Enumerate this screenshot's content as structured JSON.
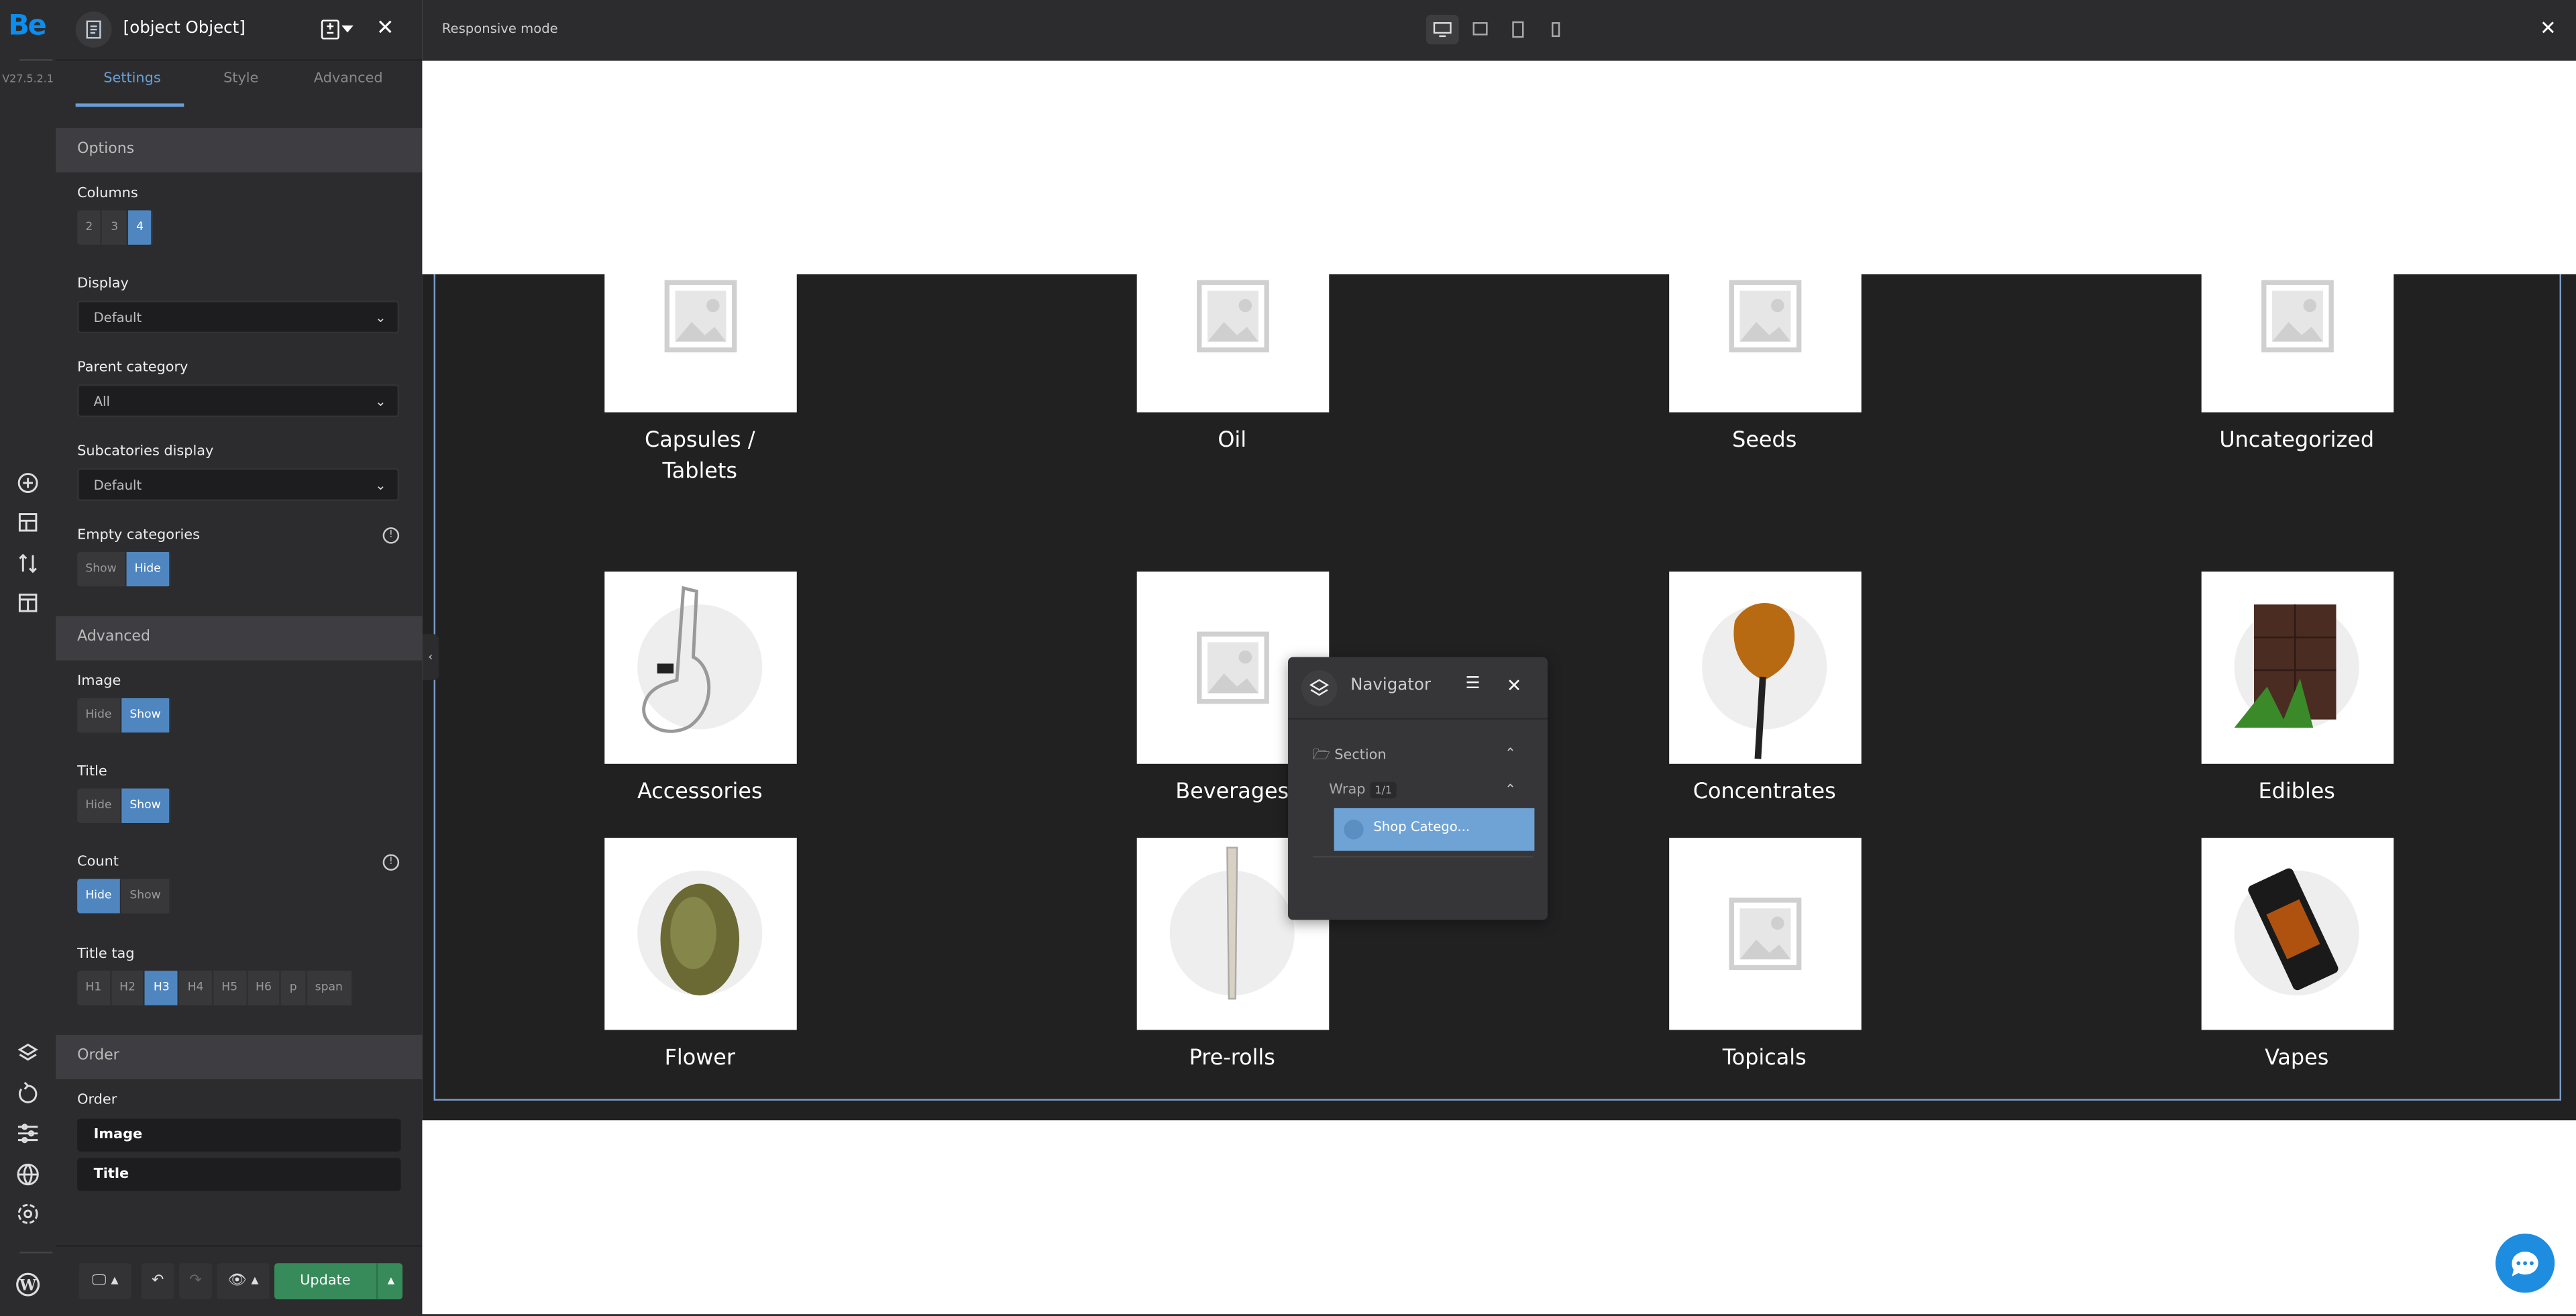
{
  "rail": {
    "logo": "Be",
    "version": "V27.5.2.1"
  },
  "panel": {
    "title": {
      "label": "Title",
      "options": [
        "Hide",
        "Show"
      ],
      "selected": "Show"
    },
    "tabs": [
      "Settings",
      "Style",
      "Advanced"
    ],
    "options_header": "Options",
    "columns": {
      "label": "Columns",
      "options": [
        "2",
        "3",
        "4"
      ],
      "selected": "4"
    },
    "display": {
      "label": "Display",
      "value": "Default"
    },
    "parent_category": {
      "label": "Parent category",
      "value": "All"
    },
    "subcategories_display": {
      "label": "Subcatories display",
      "value": "Default"
    },
    "empty_categories": {
      "label": "Empty categories",
      "options": [
        "Show",
        "Hide"
      ],
      "selected": "Hide"
    },
    "advanced_header": "Advanced",
    "image": {
      "label": "Image",
      "options": [
        "Hide",
        "Show"
      ],
      "selected": "Show"
    },
    "count": {
      "label": "Count",
      "options": [
        "Hide",
        "Show"
      ],
      "selected": "Hide"
    },
    "title_tag": {
      "label": "Title tag",
      "options": [
        "H1",
        "H2",
        "H3",
        "H4",
        "H5",
        "H6",
        "p",
        "span"
      ],
      "selected": "H3"
    },
    "order_header": "Order",
    "order": {
      "label": "Order",
      "items": [
        "Image",
        "Title"
      ]
    },
    "update_label": "Update"
  },
  "canvas": {
    "mode_label": "Responsive mode",
    "active_device": "desktop",
    "categories": [
      {
        "title": "Capsules / Tablets",
        "image": "placeholder"
      },
      {
        "title": "Oil",
        "image": "placeholder"
      },
      {
        "title": "Seeds",
        "image": "placeholder"
      },
      {
        "title": "Uncategorized",
        "image": "placeholder"
      },
      {
        "title": "Accessories",
        "image": "bong"
      },
      {
        "title": "Beverages",
        "image": "placeholder"
      },
      {
        "title": "Concentrates",
        "image": "concentrate"
      },
      {
        "title": "Edibles",
        "image": "chocolate"
      },
      {
        "title": "Flower",
        "image": "bud"
      },
      {
        "title": "Pre-rolls",
        "image": "preroll"
      },
      {
        "title": "Topicals",
        "image": "placeholder"
      },
      {
        "title": "Vapes",
        "image": "vape-cartridge"
      }
    ]
  },
  "navigator": {
    "title": "Navigator",
    "tree": [
      {
        "label": "Section"
      },
      {
        "label": "Wrap",
        "badge": "1/1"
      },
      {
        "label": "Shop Catego..."
      }
    ]
  },
  "colors": {
    "accent": "#4f86c0",
    "update": "#378a5a",
    "selected_row": "#6fa3d6"
  }
}
